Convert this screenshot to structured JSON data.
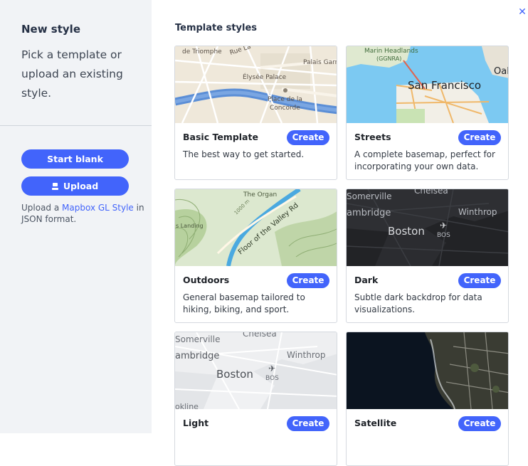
{
  "sidebar": {
    "title": "New style",
    "description": "Pick a template or upload an existing style.",
    "start_blank_label": "Start blank",
    "upload_label": "Upload",
    "hint_prefix": "Upload a ",
    "hint_link": "Mapbox GL Style",
    "hint_suffix": " in JSON format."
  },
  "close_icon": "close-icon",
  "main": {
    "title": "Template styles",
    "templates": [
      {
        "name": "Basic Template",
        "button": "Create",
        "description": "The best way to get started.",
        "map_labels": [
          "de Triomphe",
          "Rue La",
          "Palais Garn",
          "Élysée Palace",
          "Place de la",
          "Concorde"
        ]
      },
      {
        "name": "Streets",
        "button": "Create",
        "description": "A complete basemap, perfect for incorporating your own data.",
        "map_labels": [
          "Marin Headlands",
          "(GGNRA)",
          "Oal",
          "San Francisco"
        ]
      },
      {
        "name": "Outdoors",
        "button": "Create",
        "description": "General basemap tailored to hiking, biking, and sport.",
        "map_labels": [
          "The Organ",
          "Floor of the Valley Rd",
          "s Landing",
          "1000 m"
        ]
      },
      {
        "name": "Dark",
        "button": "Create",
        "description": "Subtle dark backdrop for data visualizations.",
        "map_labels": [
          "Somerville",
          "Chelsea",
          "ambridge",
          "Winthrop",
          "Boston",
          "BOS"
        ]
      },
      {
        "name": "Light",
        "button": "Create",
        "description": "",
        "map_labels": [
          "Somerville",
          "Chelsea",
          "ambridge",
          "Winthrop",
          "Boston",
          "BOS",
          "okline"
        ]
      },
      {
        "name": "Satellite",
        "button": "Create",
        "description": "",
        "map_labels": []
      }
    ]
  },
  "colors": {
    "accent": "#4264fb",
    "sidebar_bg": "#f1f3f6"
  }
}
